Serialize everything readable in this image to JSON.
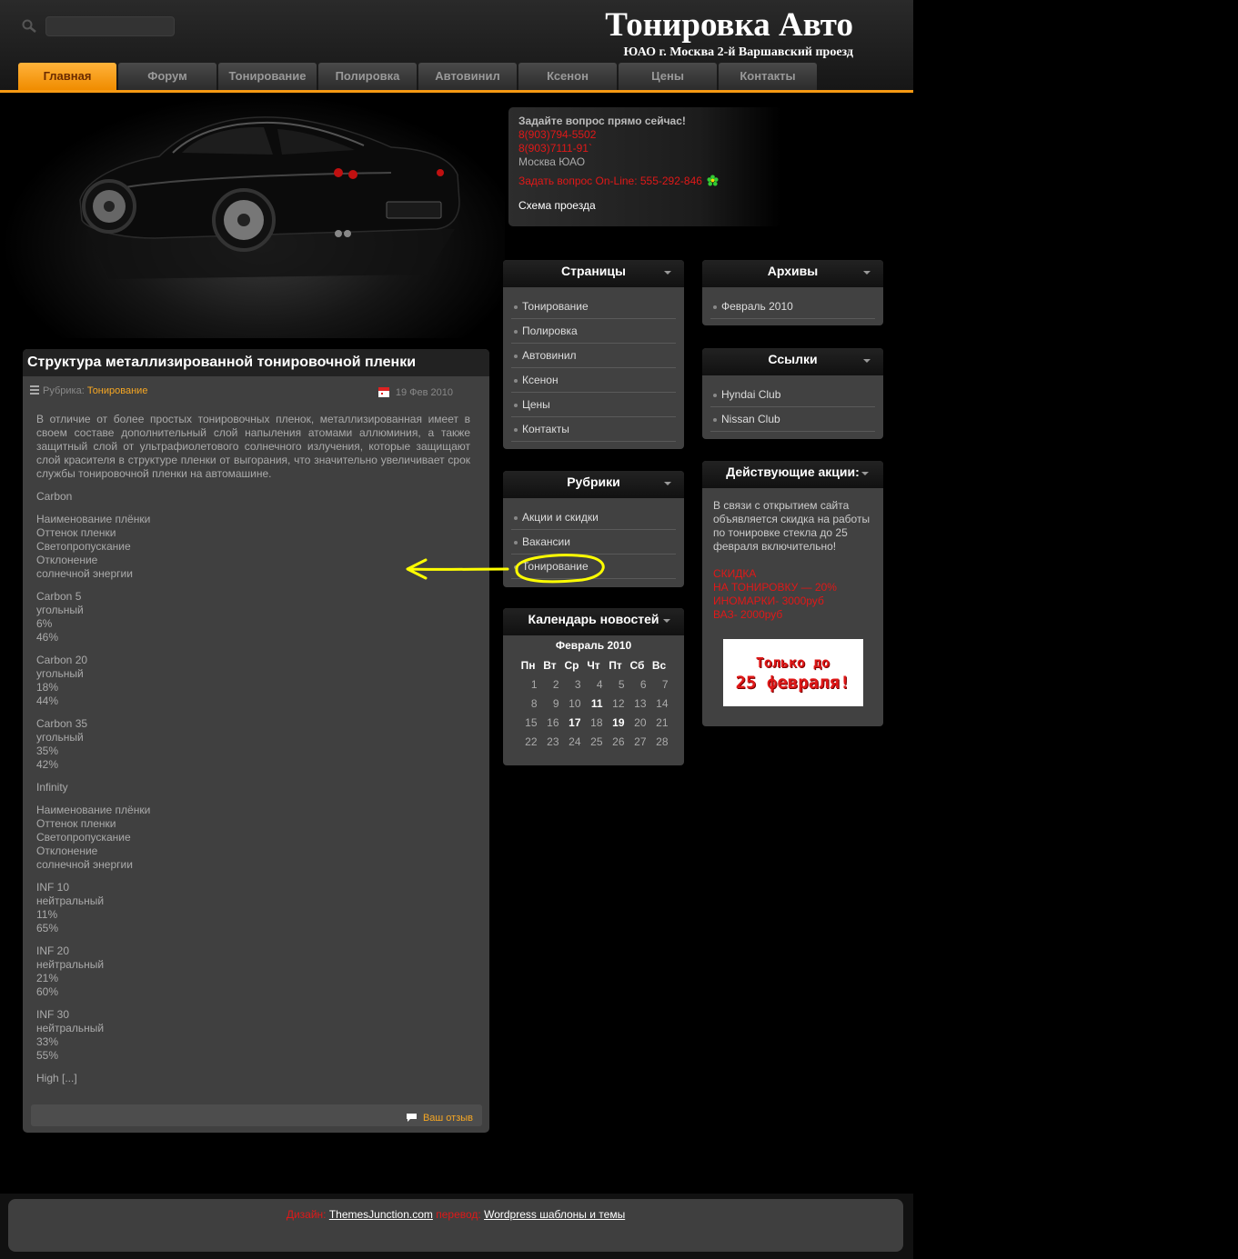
{
  "header": {
    "title": "Тонировка Авто",
    "subtitle": "ЮАО г. Москва 2-й Варшавский проезд",
    "search_placeholder": ""
  },
  "nav": {
    "tabs": [
      "Главная",
      "Форум",
      "Тонирование",
      "Полировка",
      "Автовинил",
      "Ксенон",
      "Цены",
      "Контакты"
    ],
    "active": "Главная"
  },
  "contact": {
    "question": "Задайте вопрос прямо сейчас!",
    "phone1": "8(903)794-5502",
    "phone2": "8(903)7111-91`",
    "location": "Москва ЮАО",
    "online": "Задать вопрос On-Line: 555-292-846",
    "scheme": "Схема проезда"
  },
  "post": {
    "title": "Структура металлизированной тонировочной пленки",
    "category_label": "Рубрика:",
    "category": "Тонирование",
    "date": "19 Фев 2010",
    "intro": "В отличие от более простых тонировочных пленок, металлизированная имеет в своем составе дополнительный слой напыления атомами аллюминия, а также защитный слой от ультрафиолетового солнечного излучения, которые защищают слой красителя в структуре пленки от выгорания, что значительно увеличивает срок службы тонировочной пленки на автомашине.",
    "paragraphs": [
      [
        "Carbon"
      ],
      [
        "Наименование плёнки",
        "Оттенок пленки",
        "Светопропускание",
        "Отклонение",
        "солнечной энергии"
      ],
      [
        "Carbon 5",
        "угольный",
        "6%",
        "46%"
      ],
      [
        "Carbon 20",
        "угольный",
        "18%",
        "44%"
      ],
      [
        "Carbon 35",
        "угольный",
        "35%",
        "42%"
      ],
      [
        "Infinity"
      ],
      [
        "Наименование плёнки",
        "Оттенок пленки",
        "Светопропускание",
        "Отклонение",
        "солнечной энергии"
      ],
      [
        "INF 10",
        "нейтральный",
        "11%",
        "65%"
      ],
      [
        "INF 20",
        "нейтральный",
        "21%",
        "60%"
      ],
      [
        "INF 30",
        "нейтральный",
        "33%",
        "55%"
      ],
      [
        "High [...]"
      ]
    ],
    "comment_link": "Ваш отзыв"
  },
  "pages_widget": {
    "title": "Страницы",
    "items": [
      "Тонирование",
      "Полировка",
      "Автовинил",
      "Ксенон",
      "Цены",
      "Контакты"
    ]
  },
  "archives_widget": {
    "title": "Архивы",
    "items": [
      "Февраль 2010"
    ]
  },
  "links_widget": {
    "title": "Ссылки",
    "items": [
      "Hyndai Club",
      "Nissan Club"
    ]
  },
  "categories_widget": {
    "title": "Рубрики",
    "items": [
      "Акции и скидки",
      "Вакансии",
      "Тонирование"
    ]
  },
  "promo_widget": {
    "title": "Действующие акции:",
    "text": "В связи с открытием сайта объявляется скидка на работы по тонировке стекла до 25 февраля включительно!",
    "red_lines": [
      "СКИДКА",
      "НА ТОНИРОВКУ — 20%",
      "ИНОМАРКИ- 3000руб",
      "ВАЗ- 2000руб"
    ],
    "banner_line1": "Только до",
    "banner_line2": "25 февраля!"
  },
  "calendar_widget": {
    "title": "Календарь новостей",
    "month": "Февраль 2010",
    "weekdays": [
      "Пн",
      "Вт",
      "Ср",
      "Чт",
      "Пт",
      "Сб",
      "Вс"
    ],
    "weeks": [
      [
        "1",
        "2",
        "3",
        "4",
        "5",
        "6",
        "7"
      ],
      [
        "8",
        "9",
        "10",
        "11",
        "12",
        "13",
        "14"
      ],
      [
        "15",
        "16",
        "17",
        "18",
        "19",
        "20",
        "21"
      ],
      [
        "22",
        "23",
        "24",
        "25",
        "26",
        "27",
        "28"
      ]
    ],
    "bold_days": [
      "11",
      "17",
      "19"
    ]
  },
  "footer": {
    "design_label": "Дизайн:",
    "design_link": "ThemesJunction.com",
    "translate_label": "перевод:",
    "translate_link": "Wordpress шаблоны и темы"
  },
  "colors": {
    "accent": "#f79a13",
    "red": "#e01818",
    "annotation": "#ffff00"
  }
}
